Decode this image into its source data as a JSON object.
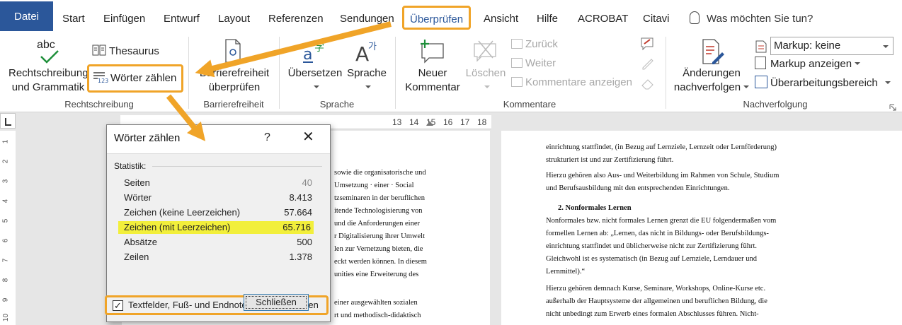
{
  "tabs": [
    {
      "id": "datei",
      "label": "Datei"
    },
    {
      "id": "start",
      "label": "Start"
    },
    {
      "id": "einfuegen",
      "label": "Einfügen"
    },
    {
      "id": "entwurf",
      "label": "Entwurf"
    },
    {
      "id": "layout",
      "label": "Layout"
    },
    {
      "id": "referenzen",
      "label": "Referenzen"
    },
    {
      "id": "sendungen",
      "label": "Sendungen"
    },
    {
      "id": "ueberpruefen",
      "label": "Überprüfen"
    },
    {
      "id": "ansicht",
      "label": "Ansicht"
    },
    {
      "id": "hilfe",
      "label": "Hilfe"
    },
    {
      "id": "acrobat",
      "label": "ACROBAT"
    },
    {
      "id": "citavi",
      "label": "Citavi"
    }
  ],
  "tellme": "Was möchten Sie tun?",
  "ribbon": {
    "rechtschreibung": {
      "group": "Rechtschreibung",
      "spelling_line1": "Rechtschreibung",
      "spelling_line2": "und Grammatik",
      "abc": "abc",
      "thesaurus": "Thesaurus",
      "word_count": "Wörter zählen"
    },
    "barrierefreiheit": {
      "group": "Barrierefreiheit",
      "line1": "Barrierefreiheit",
      "line2": "überprüfen"
    },
    "sprache": {
      "group": "Sprache",
      "translate": "Übersetzen",
      "language": "Sprache"
    },
    "kommentare": {
      "group": "Kommentare",
      "new_line1": "Neuer",
      "new_line2": "Kommentar",
      "delete": "Löschen",
      "back": "Zurück",
      "next": "Weiter",
      "show": "Kommentare anzeigen"
    },
    "nachverfolgung": {
      "group": "Nachverfolgung",
      "track_line1": "Änderungen",
      "track_line2": "nachverfolgen",
      "markup_select": "Markup: keine",
      "show_markup": "Markup anzeigen",
      "review_pane": "Überarbeitungsbereich"
    }
  },
  "ruler_numbers": [
    "13",
    "14",
    "15",
    "16",
    "17",
    "18"
  ],
  "ruler_left_numbers": [
    "1",
    "2",
    "3",
    "4",
    "5",
    "6",
    "7",
    "8",
    "9",
    "10"
  ],
  "left_page_lines": [
    "sowie die organisatorische und",
    "Umsetzung · einer · Social",
    "tzseminaren in der beruflichen",
    "itende Technologisierung von",
    "und die Anforderungen einer",
    "r Digitalisierung ihrer Umwelt",
    "len zur Vernetzung bieten, die",
    "eckt werden können. In diesem",
    "unities eine Erweiterung des",
    "einer ausgewählten sozialen",
    "rt und methodisch-didaktisch"
  ],
  "right_page": {
    "p1": [
      "einrichtung stattfindet, (in Bezug auf Lernziele, Lernzeit oder Lernförderung)",
      "strukturiert ist und zur Zertifizierung führt."
    ],
    "p2": [
      "Hierzu gehören also Aus- und Weiterbildung im Rahmen von Schule, Studium",
      "und Berufsausbildung mit den entsprechenden Einrichtungen."
    ],
    "heading": "2. Nonformales Lernen",
    "p3": [
      "Nonformales bzw. nicht formales Lernen grenzt die EU folgendermaßen vom",
      "formellen Lernen ab: „Lernen, das nicht in Bildungs- oder Berufsbildungs-",
      "einrichtung stattfindet und üblicherweise nicht zur Zertifizierung führt.",
      "Gleichwohl ist es systematisch (in Bezug auf Lernziele, Lerndauer und",
      "Lernmittel).“"
    ],
    "p4": [
      "Hierzu gehören demnach Kurse, Seminare, Workshops, Online-Kurse etc.",
      "außerhalb der Hauptsysteme der allgemeinen und beruflichen Bildung, die",
      "nicht unbedingt zum Erwerb eines formalen Abschlusses führen. Nicht-"
    ]
  },
  "dialog": {
    "title": "Wörter zählen",
    "help": "?",
    "close_icon": "close-icon",
    "section": "Statistik:",
    "rows": [
      {
        "label": "Seiten",
        "value": "40"
      },
      {
        "label": "Wörter",
        "value": "8.413"
      },
      {
        "label": "Zeichen (keine Leerzeichen)",
        "value": "57.664"
      },
      {
        "label": "Zeichen (mit Leerzeichen)",
        "value": "65.716"
      },
      {
        "label": "Absätze",
        "value": "500"
      },
      {
        "label": "Zeilen",
        "value": "1.378"
      }
    ],
    "checkbox_label": "Textfelder, Fuß- und Endnoten berücksichtigen",
    "checkbox_checked": true,
    "close_button": "Schließen"
  },
  "colors": {
    "file_tab": "#2b579a",
    "highlight_orange": "#f0a428",
    "marker_yellow": "#f2ef3b"
  }
}
